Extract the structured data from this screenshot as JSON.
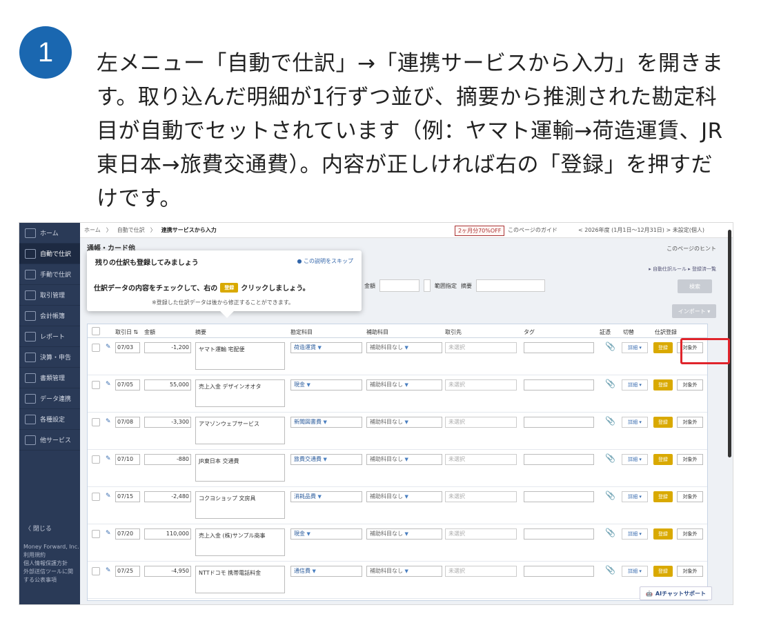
{
  "step_number": "1",
  "instruction": "左メニュー「自動で仕訳」→「連携サービスから入力」を開きます。取り込んだ明細が1行ずつ並び、摘要から推測された勘定科目が自動でセットされています（例：ヤマト運輸→荷造運賃、JR東日本→旅費交通費）。内容が正しければ右の「登録」を押すだけです。",
  "sidebar": {
    "items": [
      {
        "label": "ホーム",
        "icon": "home-icon"
      },
      {
        "label": "自動で仕訳",
        "icon": "auto-journal-icon"
      },
      {
        "label": "手動で仕訳",
        "icon": "manual-journal-icon"
      },
      {
        "label": "取引管理",
        "icon": "transaction-icon"
      },
      {
        "label": "会計帳簿",
        "icon": "ledger-icon"
      },
      {
        "label": "レポート",
        "icon": "report-icon"
      },
      {
        "label": "決算・申告",
        "icon": "tax-icon"
      },
      {
        "label": "書類管理",
        "icon": "folder-icon"
      },
      {
        "label": "データ連携",
        "icon": "link-icon"
      },
      {
        "label": "各種設定",
        "icon": "gear-icon"
      },
      {
        "label": "他サービス",
        "icon": "list-icon"
      }
    ],
    "close_label": "〈 閉じる",
    "footer": [
      "Money Forward, Inc.",
      "利用規約",
      "個人情報保護方針",
      "外部送信ツールに関",
      "する公表事項"
    ]
  },
  "topbar": {
    "crumbs": [
      "ホーム",
      "自動で仕訳",
      "連携サービスから入力"
    ],
    "promo": "2ヶ月分70%OFF",
    "help_link": "このページのガイド",
    "period": "< 2026年度 (1月1日〜12月31日) > 未設定(個人)"
  },
  "page": {
    "header": "通帳・カード他",
    "hint_link": "このページのヒント",
    "rule_link": "▸ 自動仕訳ルール ▸ 登録済一覧",
    "filter_amount_label": "金額",
    "filter_range_label": "範囲指定",
    "filter_desc_label": "摘要",
    "search_button": "検索",
    "import_button": "インポート ▾"
  },
  "tooltip": {
    "title": "残りの仕訳も登録してみましょう",
    "skip": "● この説明をスキップ",
    "message_before": "仕訳データの内容をチェックして、右の",
    "badge": "登録",
    "message_after": "クリックしましょう。",
    "note": "※登録した仕訳データは後から修正することができます。"
  },
  "table": {
    "headers": {
      "date": "取引日 ⇅",
      "amount": "金額",
      "desc": "摘要",
      "account": "勘定科目",
      "sub": "補助科目",
      "partner": "取引先",
      "tag": "タグ",
      "evidence": "証憑",
      "switch": "切替",
      "register": "仕訳登録"
    },
    "detail_label": "詳細 ▾",
    "register_label": "登録",
    "exclude_label": "対象外",
    "sub_default": "補助科目なし",
    "partner_default": "未選択",
    "rows": [
      {
        "date": "07/03",
        "amount": "-1,200",
        "desc": "ヤマト運輸 宅配便",
        "account": "荷造運賃"
      },
      {
        "date": "07/05",
        "amount": "55,000",
        "desc": "売上入金 デザインオオタ",
        "account": "現金"
      },
      {
        "date": "07/08",
        "amount": "-3,300",
        "desc": "アマゾンウェブサービス",
        "account": "新聞図書費"
      },
      {
        "date": "07/10",
        "amount": "-880",
        "desc": "JR東日本 交通費",
        "account": "旅費交通費"
      },
      {
        "date": "07/15",
        "amount": "-2,480",
        "desc": "コクヨショップ 文房具",
        "account": "消耗品費"
      },
      {
        "date": "07/20",
        "amount": "110,000",
        "desc": "売上入金 (株)サンプル商事",
        "account": "現金"
      },
      {
        "date": "07/25",
        "amount": "-4,950",
        "desc": "NTTドコモ 携帯電話料金",
        "account": "通信費"
      }
    ]
  },
  "ai_chat": "AIチャットサポート"
}
